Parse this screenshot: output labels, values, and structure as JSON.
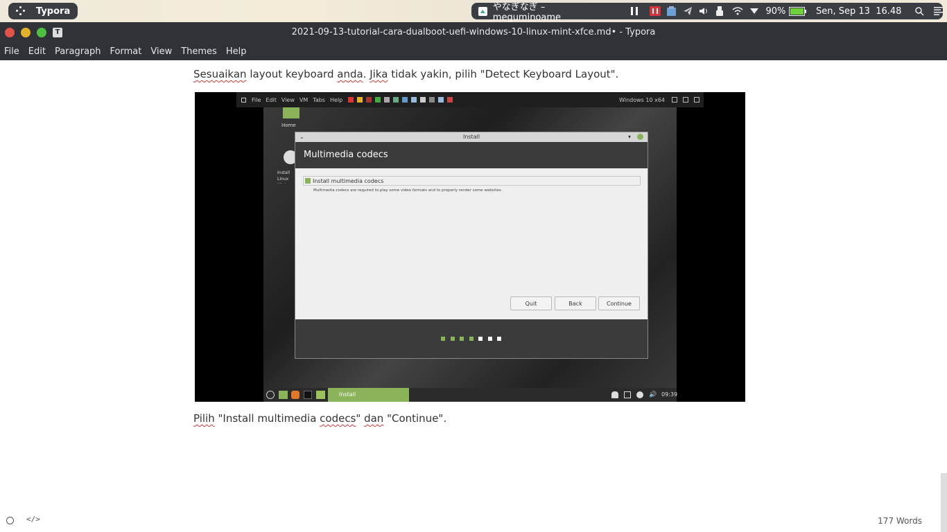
{
  "top_panel": {
    "activities_label": "Typora",
    "media_title": "やなぎなぎ – meguminoame",
    "battery": "90%",
    "clock": "Sen, Sep 13  16.48"
  },
  "window": {
    "title": "2021-09-13-tutorial-cara-dualboot-uefi-windows-10-linux-mint-xfce.md• - Typora",
    "app_icon": "T"
  },
  "menu": [
    "File",
    "Edit",
    "Paragraph",
    "Format",
    "View",
    "Themes",
    "Help"
  ],
  "content": {
    "para1_parts": [
      "Sesuaikan",
      " layout keyboard ",
      "anda",
      ". ",
      "Jika",
      " tidak yakin, pilih \"Detect Keyboard Layout\"."
    ],
    "para2_parts": [
      "Pilih",
      " \"Install multimedia ",
      "codecs",
      "\" ",
      "dan",
      " \"Continue\"."
    ]
  },
  "screenshot": {
    "vm_menu": [
      "File",
      "Edit",
      "View",
      "VM",
      "Tabs",
      "Help"
    ],
    "vm_name": "Windows 10 x64",
    "desktop_icons": [
      "Home",
      "Install Linux Mint"
    ],
    "dialog": {
      "window_title": "Install",
      "heading": "Multimedia codecs",
      "checkbox_label": "Install multimedia codecs",
      "checkbox_checked": true,
      "description": "Multimedia codecs are required to play some video formats and to properly render some websites.",
      "buttons": [
        "Quit",
        "Back",
        "Continue"
      ],
      "progress_steps_done": 4,
      "progress_steps_total": 7
    },
    "taskbar": {
      "active_app": "Install",
      "time": "09:39"
    }
  },
  "statusbar": {
    "word_count": "177 Words"
  },
  "colors": {
    "mint_green": "#8ab35a",
    "panel_dark": "#2f3237",
    "close": "#e0524a",
    "minimize": "#e5b12b",
    "maximize": "#4fbf41"
  }
}
